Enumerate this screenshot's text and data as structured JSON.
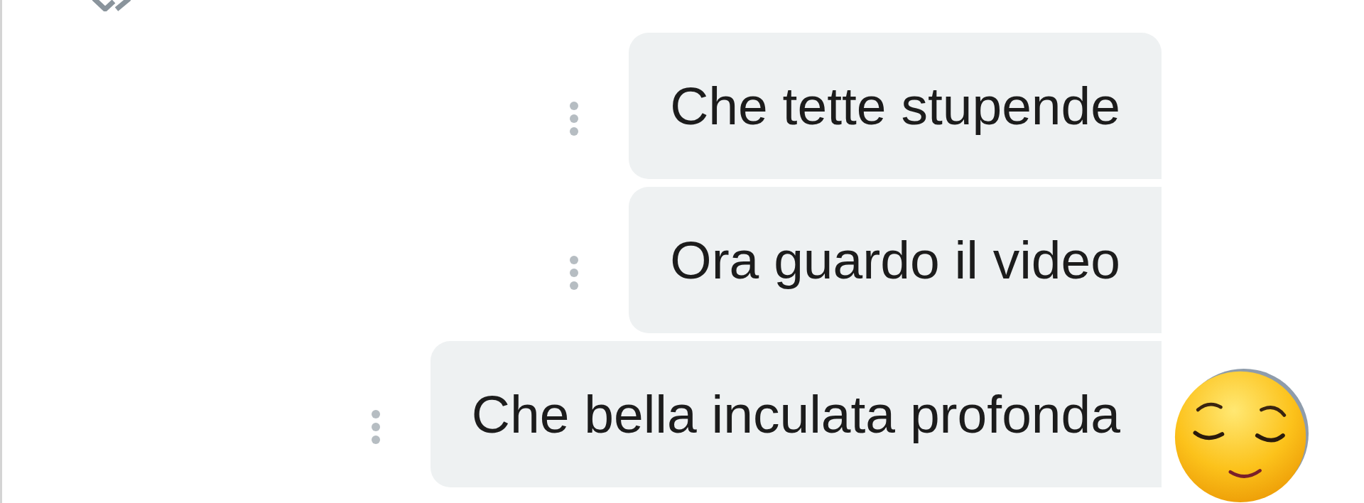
{
  "messages": [
    {
      "text": "Che tette stupende"
    },
    {
      "text": "Ora guardo il video"
    },
    {
      "text": "Che bella inculata profonda"
    }
  ]
}
